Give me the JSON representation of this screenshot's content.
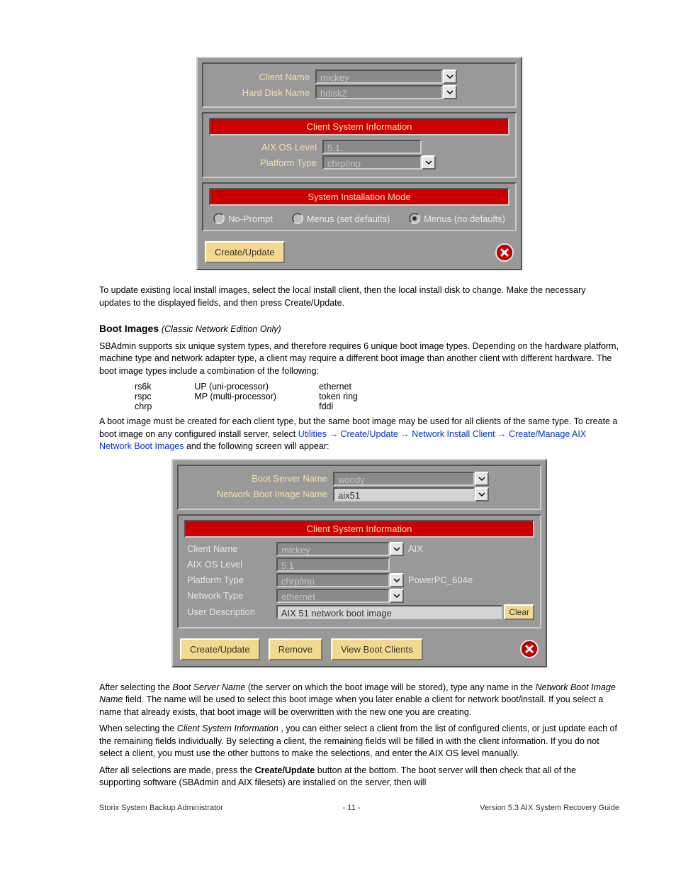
{
  "panel1": {
    "client_name_label": "Client Name",
    "client_name_value": "mickey",
    "hard_disk_label": "Hard Disk Name",
    "hard_disk_value": "hdisk2",
    "section_client_info": "Client System Information",
    "aix_os_label": "AIX OS Level",
    "aix_os_value": "5.1",
    "platform_label": "Platform Type",
    "platform_value": "chrp/mp",
    "section_install_mode": "System Installation Mode",
    "radio1": "No-Prompt",
    "radio2": "Menus (set defaults)",
    "radio3": "Menus (no defaults)",
    "create_update": "Create/Update"
  },
  "midtext": {
    "para1": "To update existing local install images, select the local install client, then the local install disk to change.  Make the necessary updates to the displayed fields, and then press Create/Update.",
    "heading1": "Boot Images",
    "heading1_sub": "     (Classic Network Edition Only)",
    "para2": "SBAdmin supports six unique system types, and therefore requires 6 unique boot image types.  Depending on the hardware platform, machine type and network adapter type, a client may require a different boot image than another client with different hardware.  The boot image types include a combination of the following:",
    "col1": "rs6k",
    "col2": "rspc",
    "col3": "chrp",
    "col4": "UP (uni-processor)",
    "col5": "MP (multi-processor)",
    "col6": "ethernet",
    "col7": "token ring",
    "col8": "fddi",
    "para3": "A boot image must be created for each client type, but the same boot image may be used for all clients of the same type. To create a boot image on any configured install server, select ",
    "nav1_a": "Utilities ",
    "nav1_b": "Create/Update ",
    "nav1_c": "Network Install ",
    "nav1_d": "Client ",
    "nav1_e": "Create/Manage AIX Network Boot Images ",
    "nav_tail": "and the following screen will appear:"
  },
  "panel2": {
    "boot_server_label": "Boot Server Name",
    "boot_server_value": "woody",
    "image_name_label": "Network Boot Image Name",
    "image_name_value": "aix51",
    "section_client_info": "Client System Information",
    "client_name_label": "Client Name",
    "client_name_value": "mickey",
    "client_name_extra": "AIX",
    "aix_os_label": "AIX OS Level",
    "aix_os_value": "5.1",
    "platform_label": "Platform Type",
    "platform_value": "chrp/mp",
    "platform_extra": "PowerPC_604e",
    "network_type_label": "Network Type",
    "network_type_value": "ethernet",
    "user_desc_label": "User Description",
    "user_desc_value": "AIX 51 network boot image",
    "clear": "Clear",
    "create_update": "Create/Update",
    "remove": "Remove",
    "view_clients": "View Boot Clients"
  },
  "bottomtext": {
    "para1_a": "After selecting the ",
    "para1_b": "Boot Server Name",
    "para1_c": " (the server on which the boot image will be stored), type any name in the ",
    "para1_d": "Network Boot Image Name",
    "para1_e": " field.  The name will be used to select this boot image when you later enable a client for network boot/install. If you select a name that already exists, that boot image will be overwritten with the new one you are creating.",
    "para2_a": "When selecting the ",
    "para2_b": "Client System Information",
    "para2_c": ", you can either select a client from the list of configured clients, or just update each of the remaining fields individually.  By selecting a client, the remaining fields will be filled in with the client information.  If you do not select a client, you must use the other buttons to make the selections, and enter the AIX OS level manually.",
    "para3_a": "After all selections are made, press the ",
    "para3_b": "Create/Update",
    "para3_c": " button at the bottom. The boot server will then check that all of the supporting software (SBAdmin and AIX filesets) are installed on the server, then will"
  },
  "footer": {
    "left": "Storix System Backup Administrator",
    "center": "- 11 -",
    "right": "Version 5.3 AIX System Recovery Guide"
  }
}
